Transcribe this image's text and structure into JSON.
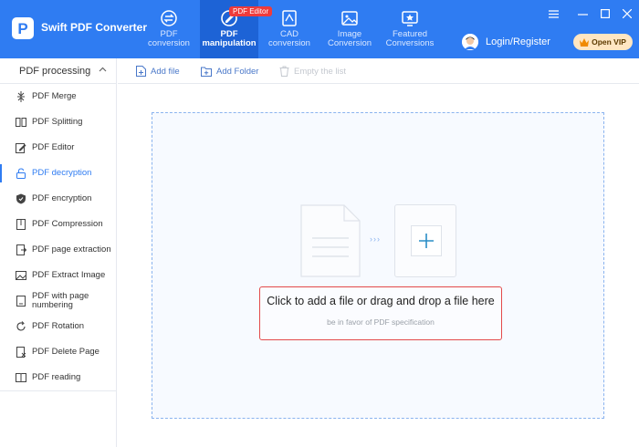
{
  "app": {
    "logo_letter": "P",
    "title": "Swift PDF Converter"
  },
  "nav": {
    "tabs": [
      {
        "line1": "PDF",
        "line2": "conversion",
        "icon": "swap-circle-icon"
      },
      {
        "line1": "PDF",
        "line2": "manipulation",
        "icon": "pdf-edit-icon",
        "active": true
      },
      {
        "line1": "CAD",
        "line2": "conversion",
        "icon": "cad-icon"
      },
      {
        "line1": "Image",
        "line2": "Conversion",
        "icon": "image-icon"
      },
      {
        "line1": "Featured",
        "line2": "Conversions",
        "icon": "star-screen-icon"
      }
    ],
    "badge": "PDF Editor"
  },
  "account": {
    "login_label": "Login/Register",
    "vip_label": "Open VIP"
  },
  "sidebar": {
    "section_title": "PDF processing",
    "items": [
      {
        "label": "PDF Merge",
        "icon": "merge-icon"
      },
      {
        "label": "PDF Splitting",
        "icon": "split-icon"
      },
      {
        "label": "PDF Editor",
        "icon": "edit-icon"
      },
      {
        "label": "PDF decryption",
        "icon": "unlock-icon",
        "active": true
      },
      {
        "label": "PDF encryption",
        "icon": "shield-icon"
      },
      {
        "label": "PDF Compression",
        "icon": "compress-icon"
      },
      {
        "label": "PDF page extraction",
        "icon": "extract-icon"
      },
      {
        "label": "PDF Extract Image",
        "icon": "image-icon"
      },
      {
        "label": "PDF with page numbering",
        "label_line1": "PDF with page",
        "label_line2": "numbering",
        "icon": "numbering-icon"
      },
      {
        "label": "PDF Rotation",
        "icon": "rotate-icon"
      },
      {
        "label": "PDF Delete Page",
        "icon": "delete-page-icon"
      },
      {
        "label": "PDF reading",
        "icon": "book-icon"
      }
    ]
  },
  "toolbar": {
    "add_file": "Add file",
    "add_folder": "Add Folder",
    "empty_list": "Empty the list"
  },
  "dropzone": {
    "main_text": "Click to add a file or drag and drop a file here",
    "sub_text": "be in favor of PDF specification",
    "arrows": "›››"
  },
  "colors": {
    "brand": "#2f7cf2",
    "active_tab": "#1d63d6",
    "badge": "#ef3b3b",
    "highlight_border": "#e34a4a"
  }
}
